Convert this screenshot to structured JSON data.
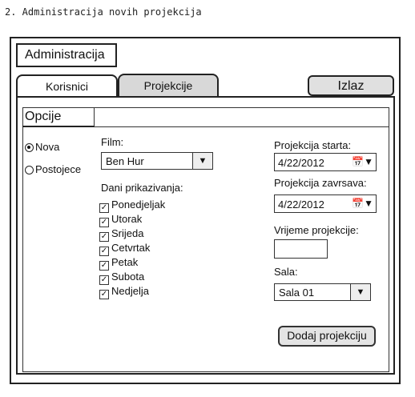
{
  "caption": "2. Administracija novih projekcija",
  "window": {
    "title": "Administracija"
  },
  "tabs": [
    {
      "label": "Korisnici",
      "active": false
    },
    {
      "label": "Projekcije",
      "active": true
    }
  ],
  "exit_button": "Izlaz",
  "options": {
    "heading": "Opcije",
    "radios": [
      {
        "label": "Nova",
        "selected": true
      },
      {
        "label": "Postojece",
        "selected": false
      }
    ]
  },
  "form": {
    "film_label": "Film:",
    "film_value": "Ben Hur",
    "days_label": "Dani prikazivanja:",
    "days": [
      {
        "label": "Ponedjeljak",
        "checked": true
      },
      {
        "label": "Utorak",
        "checked": true
      },
      {
        "label": "Srijeda",
        "checked": true
      },
      {
        "label": "Cetvrtak",
        "checked": true
      },
      {
        "label": "Petak",
        "checked": true
      },
      {
        "label": "Subota",
        "checked": true
      },
      {
        "label": "Nedjelja",
        "checked": true
      }
    ],
    "start_label": "Projekcija starta:",
    "start_value": "4/22/2012",
    "end_label": "Projekcija zavrsava:",
    "end_value": "4/22/2012",
    "time_label": "Vrijeme projekcije:",
    "time_value": "",
    "hall_label": "Sala:",
    "hall_value": "Sala 01",
    "submit_label": "Dodaj projekciju"
  },
  "icons": {
    "dropdown": "chevron-down-icon",
    "calendar": "calendar-icon",
    "check": "checkmark-icon"
  }
}
